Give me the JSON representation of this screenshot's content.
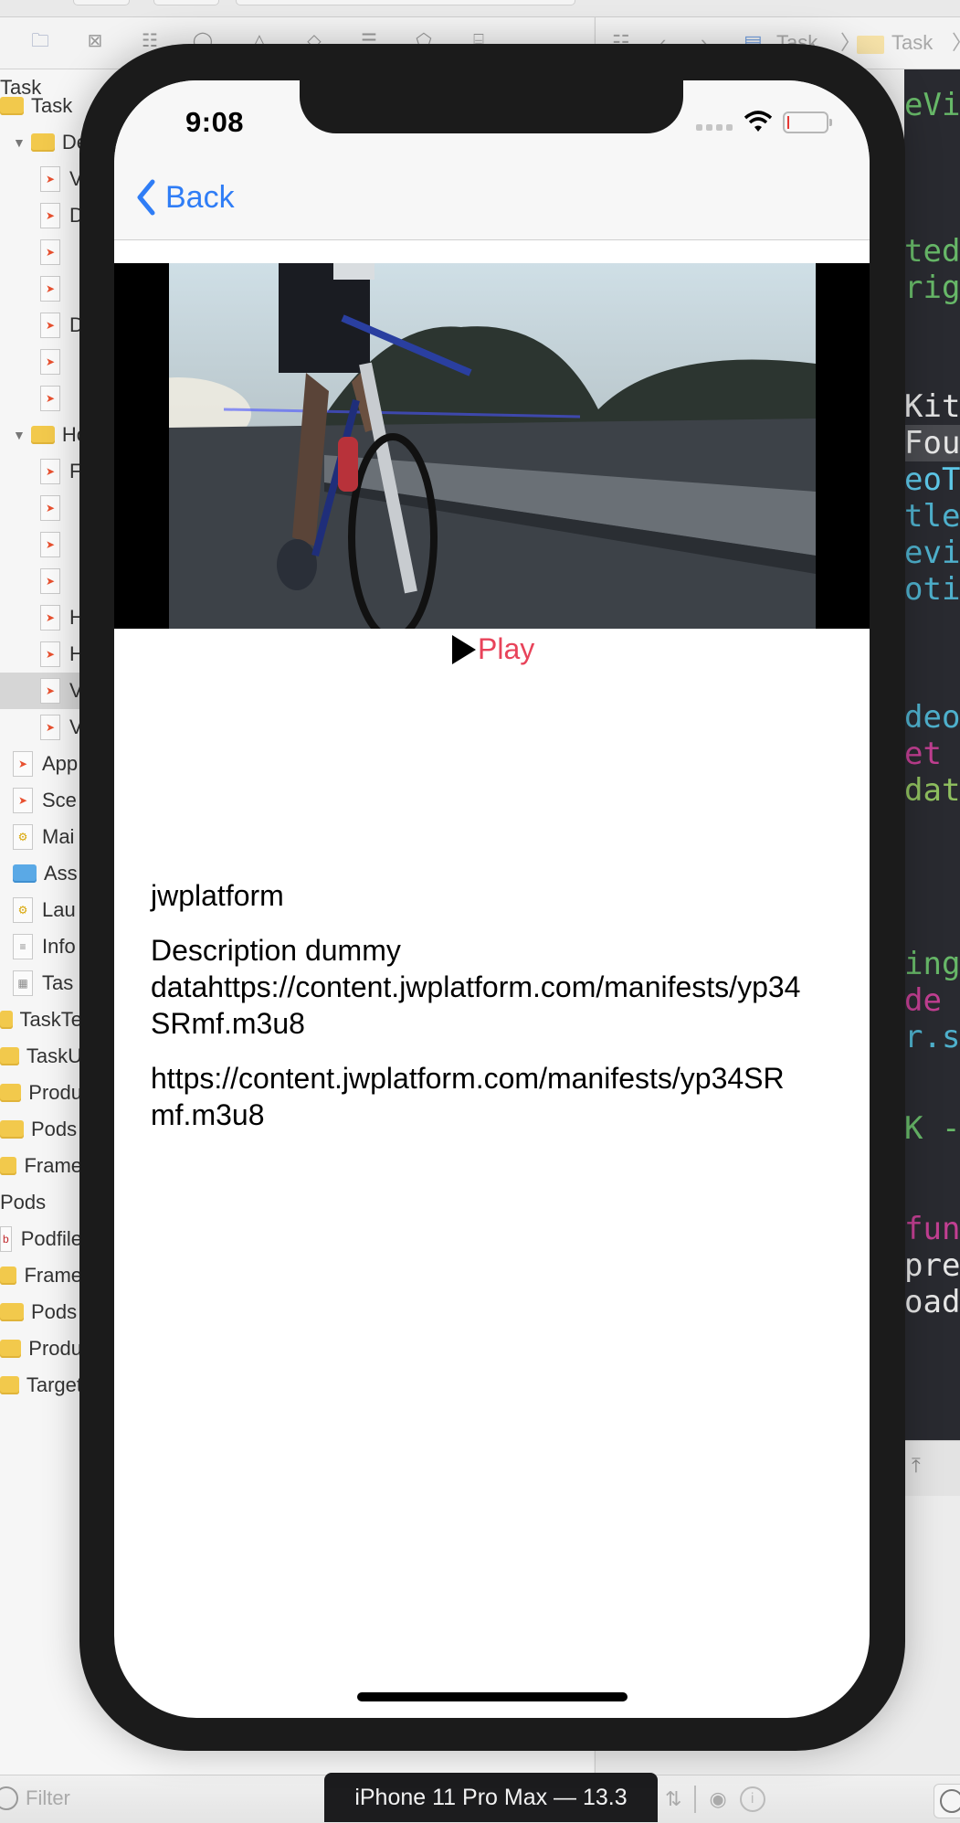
{
  "xcode": {
    "navigator_icons": [
      "folder-icon",
      "source-control-icon",
      "hierarchy-icon",
      "search-icon",
      "warning-icon",
      "test-icon",
      "debug-icon",
      "breakpoint-icon",
      "report-icon"
    ],
    "jumpbar": {
      "crumbs": [
        "Task",
        "Task"
      ]
    },
    "project_root": "Task",
    "tree": [
      {
        "label": "Task",
        "kind": "folder",
        "level": 1
      },
      {
        "label": "Det",
        "kind": "folder",
        "level": 2,
        "expanded": true
      },
      {
        "label": "V",
        "kind": "swift",
        "level": 3
      },
      {
        "label": "D",
        "kind": "swift",
        "level": 3
      },
      {
        "label": "",
        "kind": "swift",
        "level": 3
      },
      {
        "label": "",
        "kind": "swift",
        "level": 3
      },
      {
        "label": "D",
        "kind": "swift",
        "level": 3
      },
      {
        "label": "",
        "kind": "swift",
        "level": 3
      },
      {
        "label": "",
        "kind": "swift",
        "level": 3
      },
      {
        "label": "Ho",
        "kind": "folder",
        "level": 2,
        "expanded": true
      },
      {
        "label": "F",
        "kind": "swift",
        "level": 3
      },
      {
        "label": "",
        "kind": "swift",
        "level": 3
      },
      {
        "label": "",
        "kind": "swift",
        "level": 3
      },
      {
        "label": "",
        "kind": "swift",
        "level": 3
      },
      {
        "label": "H",
        "kind": "swift",
        "level": 3
      },
      {
        "label": "H",
        "kind": "swift",
        "level": 3
      },
      {
        "label": "V",
        "kind": "swift",
        "level": 3,
        "selected": true
      },
      {
        "label": "V",
        "kind": "swift",
        "level": 3
      },
      {
        "label": "App",
        "kind": "swift",
        "level": 2
      },
      {
        "label": "Sce",
        "kind": "swift",
        "level": 2
      },
      {
        "label": "Mai",
        "kind": "storyboard",
        "level": 2
      },
      {
        "label": "Ass",
        "kind": "assets",
        "level": 2
      },
      {
        "label": "Lau",
        "kind": "storyboard",
        "level": 2
      },
      {
        "label": "Info",
        "kind": "plist",
        "level": 2
      },
      {
        "label": "Tas",
        "kind": "xcdatamodel",
        "level": 2
      },
      {
        "label": "TaskTe",
        "kind": "folder",
        "level": 1
      },
      {
        "label": "TaskU",
        "kind": "folder",
        "level": 1
      },
      {
        "label": "Produ",
        "kind": "folder",
        "level": 1
      },
      {
        "label": "Pods",
        "kind": "folder",
        "level": 1
      },
      {
        "label": "Frame",
        "kind": "folder",
        "level": 1
      },
      {
        "label": "Pods",
        "kind": "project",
        "level": 0
      },
      {
        "label": "Podfile",
        "kind": "podfile",
        "level": 1
      },
      {
        "label": "Frame",
        "kind": "folder",
        "level": 1
      },
      {
        "label": "Pods",
        "kind": "folder",
        "level": 1
      },
      {
        "label": "Produ",
        "kind": "folder",
        "level": 1
      },
      {
        "label": "Target",
        "kind": "folder",
        "level": 1
      }
    ],
    "code_fragments": [
      {
        "text": "eVie",
        "color": "#67b868"
      },
      {
        "text": "ted ",
        "color": "#67b868"
      },
      {
        "text": "righ",
        "color": "#67b868"
      },
      {
        "text": "Kit",
        "color": "#e6e6e6"
      },
      {
        "text": "Fou",
        "color": "#e6e6e6",
        "highlight": true
      },
      {
        "text": "eoT",
        "color": "#5dc7e8"
      },
      {
        "text": "tleL",
        "color": "#4eb0cc"
      },
      {
        "text": "evie",
        "color": "#4eb0cc"
      },
      {
        "text": "otit",
        "color": "#4eb0cc"
      },
      {
        "text": "deo:",
        "color": "#4eb0cc"
      },
      {
        "text": "et -",
        "color": "#c23f92"
      },
      {
        "text": "date",
        "color": "#8fbf5f"
      },
      {
        "text": "ing ",
        "color": "#67b868"
      },
      {
        "text": "de T",
        "color": "#c23f92"
      },
      {
        "text": "r.se",
        "color": "#4eb0cc"
      },
      {
        "text": "K -",
        "color": "#67b868"
      },
      {
        "text": "func",
        "color": "#c23f92"
      },
      {
        "text": "prev",
        "color": "#e6e6e6"
      },
      {
        "text": "oadd",
        "color": "#e6e6e6"
      }
    ],
    "filter_placeholder": "Filter",
    "device_label": "iPhone 11 Pro Max — 13.3"
  },
  "phone": {
    "status": {
      "time": "9:08",
      "battery_level": 0.05
    },
    "nav": {
      "back_label": "Back",
      "accent": "#2f7df6"
    },
    "video": {
      "play_label": "Play",
      "play_color": "#e8435a"
    },
    "details": {
      "title": "jwplatform",
      "description": "Description dummy datahttps://content.jwplatform.com/manifests/yp34SRmf.m3u8",
      "url": "https://content.jwplatform.com/manifests/yp34SRmf.m3u8"
    }
  }
}
